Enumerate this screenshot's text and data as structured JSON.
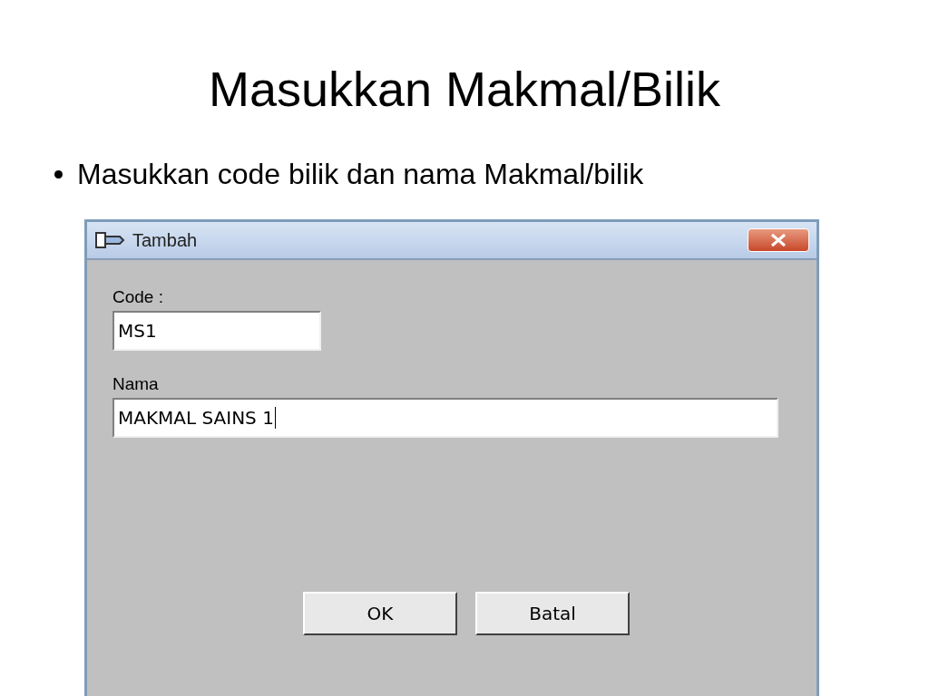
{
  "slide": {
    "title": "Masukkan Makmal/Bilik",
    "bullets": [
      "Masukkan code bilik dan nama Makmal/bilik"
    ]
  },
  "dialog": {
    "title": "Tambah",
    "fields": [
      {
        "label": "Code :",
        "value": "MS1",
        "focused": false
      },
      {
        "label": "Nama",
        "value": "MAKMAL SAINS 1",
        "focused": true
      }
    ],
    "buttons": [
      "OK",
      "Batal"
    ]
  }
}
